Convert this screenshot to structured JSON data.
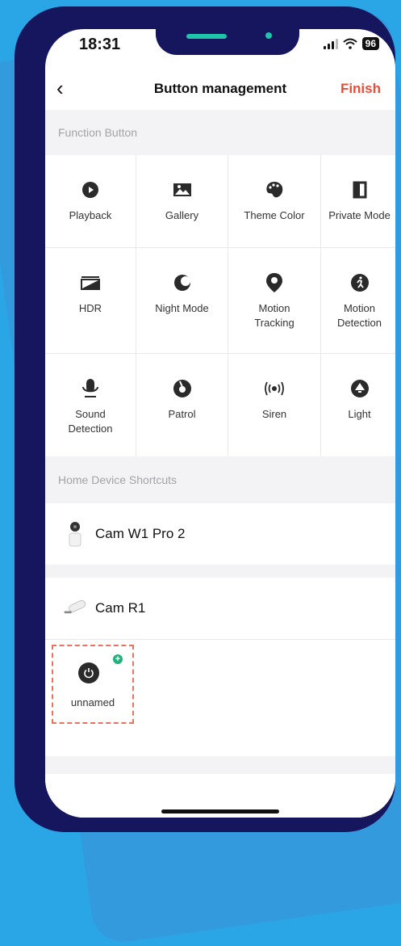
{
  "status": {
    "time": "18:31",
    "battery": "96"
  },
  "nav": {
    "back": "‹",
    "title": "Button management",
    "finish": "Finish"
  },
  "sections": {
    "function_button": "Function Button",
    "home_shortcuts": "Home Device Shortcuts"
  },
  "functions": [
    {
      "label": "Playback",
      "icon": "play-icon"
    },
    {
      "label": "Gallery",
      "icon": "gallery-icon"
    },
    {
      "label": "Theme Color",
      "icon": "palette-icon"
    },
    {
      "label": "Private Mode",
      "icon": "private-mode-icon"
    },
    {
      "label": "HDR",
      "icon": "hdr-icon"
    },
    {
      "label": "Night Mode",
      "icon": "moon-icon"
    },
    {
      "label": "Motion\nTracking",
      "icon": "location-pin-icon"
    },
    {
      "label": "Motion\nDetection",
      "icon": "running-person-icon"
    },
    {
      "label": "Sound\nDetection",
      "icon": "microphone-icon"
    },
    {
      "label": "Patrol",
      "icon": "patrol-icon"
    },
    {
      "label": "Siren",
      "icon": "siren-icon"
    },
    {
      "label": "Light",
      "icon": "light-icon"
    }
  ],
  "devices": [
    {
      "name": "Cam W1 Pro 2",
      "icon": "indoor-camera-icon"
    },
    {
      "name": "Cam R1",
      "icon": "bullet-camera-icon"
    }
  ],
  "shortcut": {
    "label": "unnamed",
    "icon": "power-icon",
    "badge": "+"
  }
}
